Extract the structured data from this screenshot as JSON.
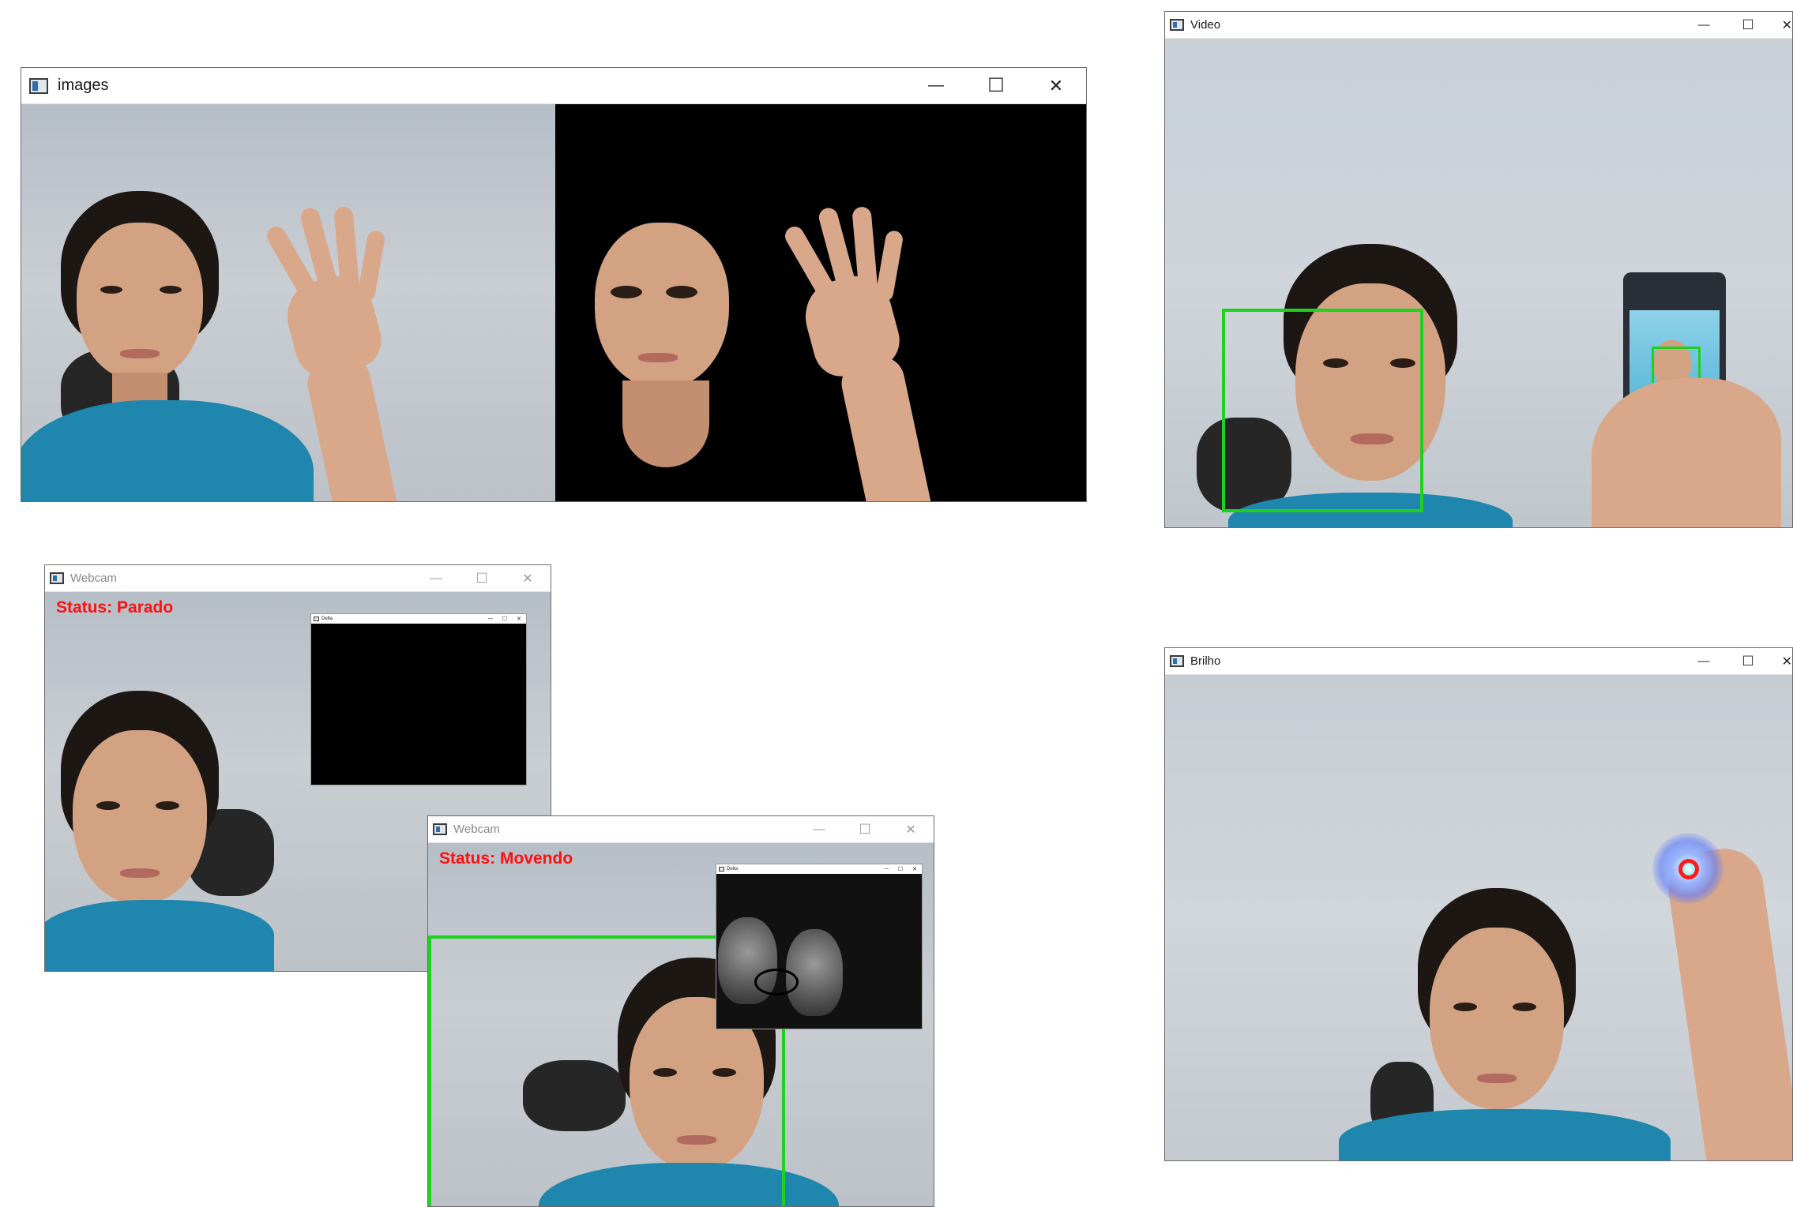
{
  "windows": {
    "images": {
      "title": "images"
    },
    "video": {
      "title": "Video"
    },
    "webcam1": {
      "title": "Webcam",
      "status": "Status:  Parado",
      "delta": {
        "title": "Delta"
      }
    },
    "webcam2": {
      "title": "Webcam",
      "status": "Status:  Movendo",
      "delta": {
        "title": "Delta"
      }
    },
    "brilho": {
      "title": "Brilho"
    }
  },
  "controls": {
    "minimize": "—",
    "maximize": "☐",
    "close": "✕"
  },
  "colors": {
    "status_text": "#ff1010",
    "detection_box": "#1fd11f",
    "bright_spot_ring": "#ff1a1a",
    "shirt": "#1f86ad"
  },
  "icons": {
    "window": "app-window-icon",
    "minimize": "minimize-icon",
    "maximize": "maximize-icon",
    "close": "close-icon"
  }
}
